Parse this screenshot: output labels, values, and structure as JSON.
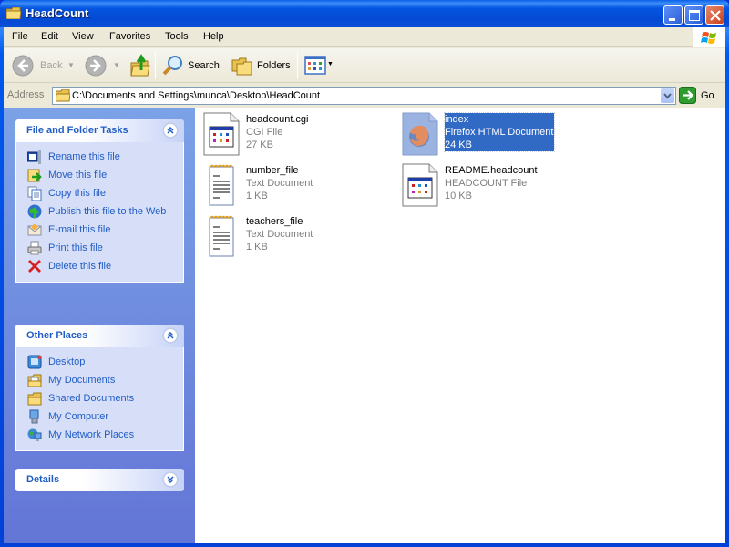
{
  "window": {
    "title": "HeadCount",
    "controls": {
      "minimize": "minimize",
      "maximize": "maximize",
      "close": "close"
    }
  },
  "menubar": {
    "items": [
      "File",
      "Edit",
      "View",
      "Favorites",
      "Tools",
      "Help"
    ]
  },
  "toolbar": {
    "back_label": "Back",
    "search_label": "Search",
    "folders_label": "Folders"
  },
  "address": {
    "label": "Address",
    "value": "C:\\Documents and Settings\\munca\\Desktop\\HeadCount",
    "go_label": "Go"
  },
  "sidebar": {
    "file_tasks": {
      "title": "File and Folder Tasks",
      "items": [
        {
          "label": "Rename this file",
          "icon": "rename-icon"
        },
        {
          "label": "Move this file",
          "icon": "move-icon"
        },
        {
          "label": "Copy this file",
          "icon": "copy-icon"
        },
        {
          "label": "Publish this file to the Web",
          "icon": "publish-web-icon"
        },
        {
          "label": "E-mail this file",
          "icon": "email-icon"
        },
        {
          "label": "Print this file",
          "icon": "printer-icon"
        },
        {
          "label": "Delete this file",
          "icon": "delete-icon"
        }
      ]
    },
    "other_places": {
      "title": "Other Places",
      "items": [
        {
          "label": "Desktop",
          "icon": "desktop-icon"
        },
        {
          "label": "My Documents",
          "icon": "my-documents-icon"
        },
        {
          "label": "Shared Documents",
          "icon": "folder-icon"
        },
        {
          "label": "My Computer",
          "icon": "my-computer-icon"
        },
        {
          "label": "My Network Places",
          "icon": "network-places-icon"
        }
      ]
    },
    "details": {
      "title": "Details"
    }
  },
  "files": [
    {
      "name": "headcount.cgi",
      "type": "CGI File",
      "size": "27 KB",
      "icon": "app-file-icon",
      "selected": false
    },
    {
      "name": "index",
      "type": "Firefox HTML Document",
      "size": "24 KB",
      "icon": "firefox-document-icon",
      "selected": true
    },
    {
      "name": "number_file",
      "type": "Text Document",
      "size": "1 KB",
      "icon": "text-document-icon",
      "selected": false
    },
    {
      "name": "README.headcount",
      "type": "HEADCOUNT File",
      "size": "10 KB",
      "icon": "app-file-icon",
      "selected": false
    },
    {
      "name": "teachers_file",
      "type": "Text Document",
      "size": "1 KB",
      "icon": "text-document-icon",
      "selected": false
    }
  ],
  "colors": {
    "titlebar": "#0556e2",
    "sidebar_link": "#215dc6",
    "selection": "#316ac5",
    "sidebar_bg": "#6f8ce0"
  }
}
